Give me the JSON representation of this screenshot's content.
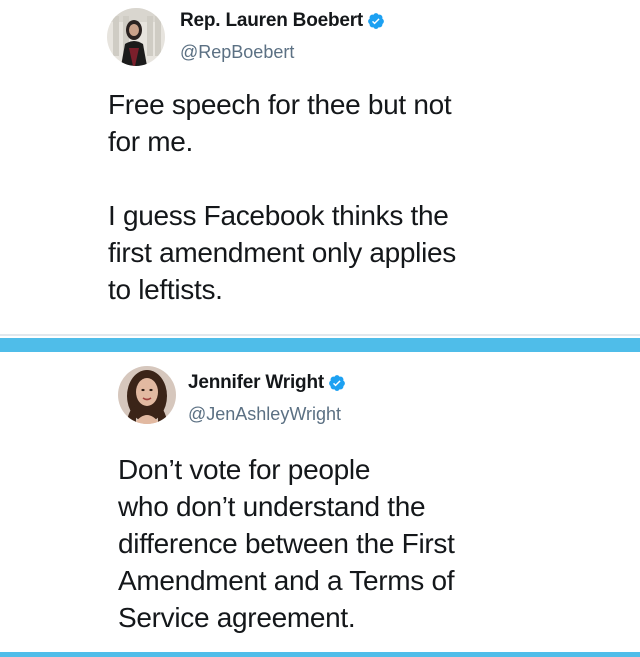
{
  "tweets": [
    {
      "name": "Rep. Lauren Boebert",
      "handle": "@RepBoebert",
      "verified": true,
      "text": "Free speech for thee but not\nfor me.\n\nI guess Facebook thinks the\nfirst amendment only applies\nto leftists."
    },
    {
      "name": "Jennifer Wright",
      "handle": "@JenAshleyWright",
      "verified": true,
      "text": "Don’t vote for people\nwho don’t understand the\ndifference between the First\nAmendment and a Terms of\nService agreement."
    }
  ],
  "colors": {
    "accent": "#4fbde9",
    "verified_badge": "#1da1f2",
    "handle": "#5b7083",
    "text": "#14171a"
  },
  "icons": {
    "verified": "verified-badge-icon",
    "avatar_1": "profile-photo-icon",
    "avatar_2": "profile-photo-icon"
  }
}
